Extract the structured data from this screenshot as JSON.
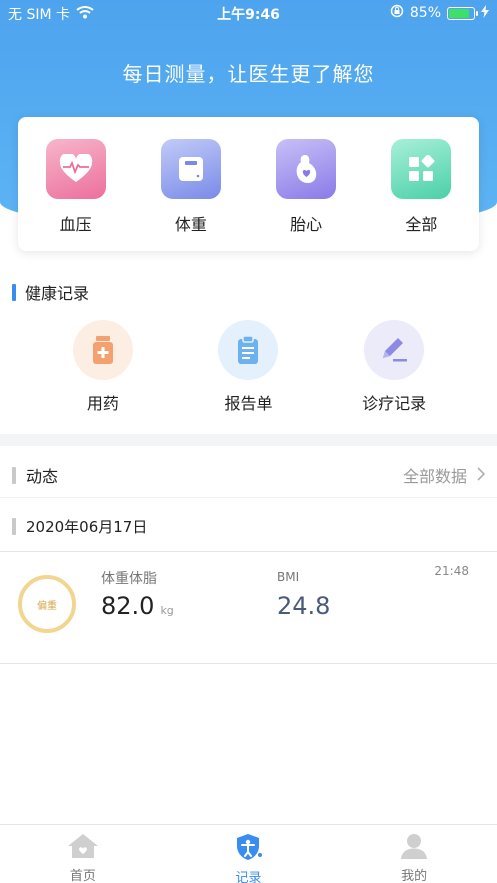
{
  "status_bar": {
    "carrier": "无 SIM 卡",
    "time": "上午9:46",
    "battery": "85%",
    "battery_level": 0.85
  },
  "hero": {
    "title": "每日测量，让医生更了解您"
  },
  "quick_actions": [
    {
      "label": "血压",
      "icon": "heart-pulse-icon",
      "color": "#ec6f9b"
    },
    {
      "label": "体重",
      "icon": "scale-icon",
      "color": "#6f7fe8"
    },
    {
      "label": "胎心",
      "icon": "fetal-heart-icon",
      "color": "#8a7ae8"
    },
    {
      "label": "全部",
      "icon": "grid-icon",
      "color": "#4ad0a8"
    }
  ],
  "health": {
    "title": "健康记录",
    "items": [
      {
        "label": "用药",
        "icon": "medicine-bottle-icon"
      },
      {
        "label": "报告单",
        "icon": "clipboard-icon"
      },
      {
        "label": "诊疗记录",
        "icon": "pen-icon"
      }
    ]
  },
  "dynamics": {
    "title": "动态",
    "all_data": "全部数据"
  },
  "date_group": "2020年06月17日",
  "entry": {
    "badge": "偏重",
    "caption1": "体重体脂",
    "weight": "82.0",
    "unit": "kg",
    "caption2": "BMI",
    "bmi": "24.8",
    "time": "21:48"
  },
  "tabs": [
    {
      "label": "首页",
      "icon": "home-icon",
      "active": false
    },
    {
      "label": "记录",
      "icon": "record-shield-icon",
      "active": true
    },
    {
      "label": "我的",
      "icon": "person-icon",
      "active": false
    }
  ],
  "colors": {
    "accent": "#3b8cf0",
    "hero": "#5db5f4"
  }
}
